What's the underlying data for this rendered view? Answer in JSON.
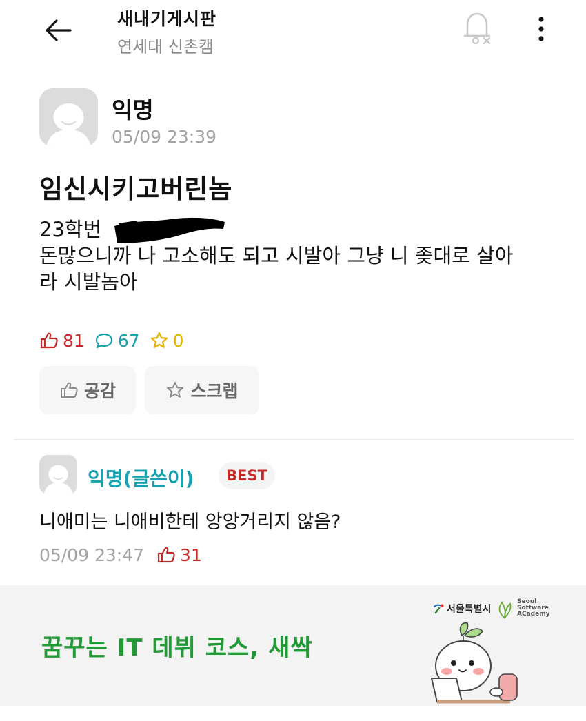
{
  "header": {
    "title": "새내기게시판",
    "subtitle": "연세대 신촌캠",
    "icons": [
      "back-arrow-icon",
      "bell-off-icon",
      "more-vertical-icon"
    ]
  },
  "post": {
    "author": "익명",
    "time": "05/09 23:39",
    "title": "임신시키고버린놈",
    "body_line1": "23학번",
    "body_line2": "돈많으니까 나 고소해도 되고 시발아 그냥 니 좆대로 살아",
    "body_line3": "라 시발놈아",
    "likes": "81",
    "comments": "67",
    "scraps": "0"
  },
  "actions": {
    "like_label": "공감",
    "scrap_label": "스크랩"
  },
  "comment": {
    "author": "익명(글쓴이)",
    "badge": "BEST",
    "text": "니애미는 니애비한테 앙앙거리지 않음?",
    "time": "05/09 23:47",
    "likes": "31"
  },
  "ad": {
    "headline": "꿈꾸는 IT 데뷔 코스, 새싹",
    "seoul_logo": "서울특별시",
    "academy_logo": "Seoul\nSoftware\nACademy"
  },
  "colors": {
    "accent_red": "#c62828",
    "accent_teal": "#17a1b0",
    "accent_yellow": "#e6b400",
    "ad_green": "#1f9a35"
  }
}
